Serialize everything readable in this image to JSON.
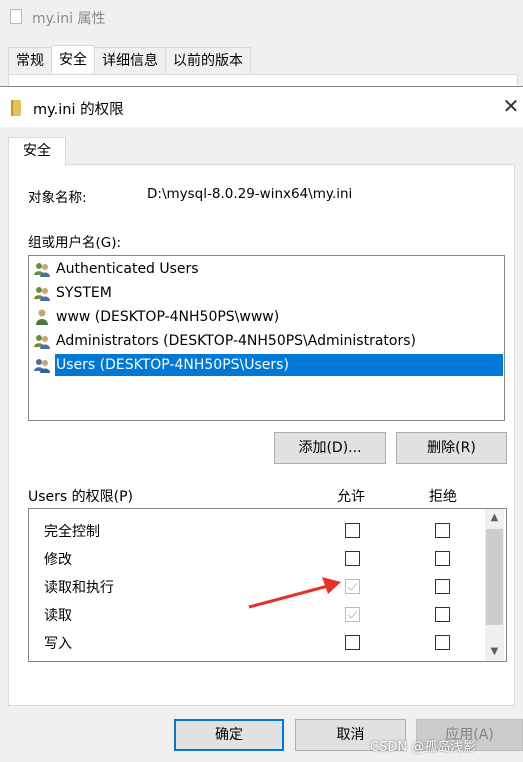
{
  "back_window": {
    "title": "my.ini 属性",
    "tabs": [
      {
        "label": "常规",
        "active": false
      },
      {
        "label": "安全",
        "active": true
      },
      {
        "label": "详细信息",
        "active": false
      },
      {
        "label": "以前的版本",
        "active": false
      }
    ]
  },
  "dialog": {
    "title": "my.ini 的权限",
    "close_symbol": "✕",
    "tab_label": "安全",
    "object_name_label": "对象名称:",
    "object_name_value": "D:\\mysql-8.0.29-winx64\\my.ini",
    "group_label": "组或用户名(G):",
    "users": [
      {
        "name": "Authenticated Users",
        "icon": "users-group-icon",
        "selected": false
      },
      {
        "name": "SYSTEM",
        "icon": "users-group-icon",
        "selected": false
      },
      {
        "name": "www (DESKTOP-4NH50PS\\www)",
        "icon": "user-icon",
        "selected": false
      },
      {
        "name": "Administrators (DESKTOP-4NH50PS\\Administrators)",
        "icon": "users-group-icon",
        "selected": false
      },
      {
        "name": "Users (DESKTOP-4NH50PS\\Users)",
        "icon": "users-group-icon",
        "selected": true
      }
    ],
    "add_button": "添加(D)...",
    "remove_button": "删除(R)",
    "permissions_label": "Users 的权限(P)",
    "allow_header": "允许",
    "deny_header": "拒绝",
    "permissions": [
      {
        "name": "完全控制",
        "allow": false,
        "allow_disabled": false,
        "deny": false
      },
      {
        "name": "修改",
        "allow": false,
        "allow_disabled": false,
        "deny": false
      },
      {
        "name": "读取和执行",
        "allow": true,
        "allow_disabled": true,
        "deny": false
      },
      {
        "name": "读取",
        "allow": true,
        "allow_disabled": true,
        "deny": false
      },
      {
        "name": "写入",
        "allow": false,
        "allow_disabled": false,
        "deny": false
      }
    ],
    "ok_button": "确定",
    "cancel_button": "取消",
    "apply_button": "应用(A)"
  },
  "watermark": "CSDN @孤岛浅影",
  "colors": {
    "selection": "#0078d7",
    "annotation_arrow": "#e8302a",
    "disabled_check": "#bcbcbc"
  }
}
